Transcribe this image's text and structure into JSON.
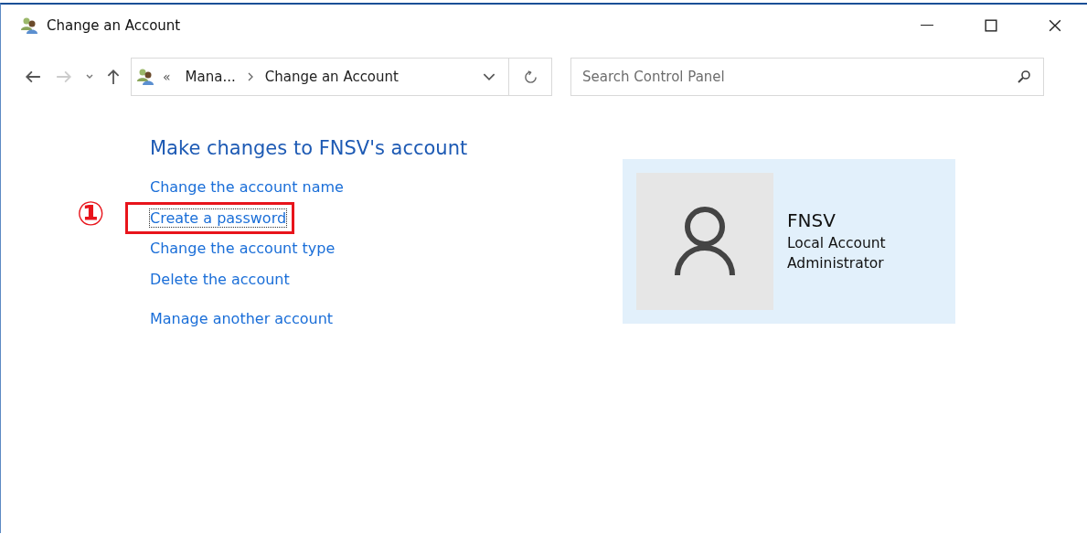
{
  "window": {
    "title": "Change an Account"
  },
  "navigation": {
    "back": {
      "disabled": false
    },
    "forward": {
      "disabled": true
    }
  },
  "address_bar": {
    "overflow": "«",
    "crumbs": [
      "Mana...",
      "Change an Account"
    ]
  },
  "search": {
    "placeholder": "Search Control Panel"
  },
  "heading": "Make changes to FNSV's account",
  "links": [
    {
      "label": "Change the account name",
      "focused": false,
      "highlighted": false
    },
    {
      "label": "Create a password",
      "focused": true,
      "highlighted": true
    },
    {
      "label": "Change the account type",
      "focused": false,
      "highlighted": false
    },
    {
      "label": "Delete the account",
      "focused": false,
      "highlighted": false
    },
    {
      "label": "Manage another account",
      "focused": false,
      "highlighted": false,
      "separated": true
    }
  ],
  "annotation": {
    "marker": "①"
  },
  "account": {
    "name": "FNSV",
    "type": "Local Account",
    "role": "Administrator"
  }
}
